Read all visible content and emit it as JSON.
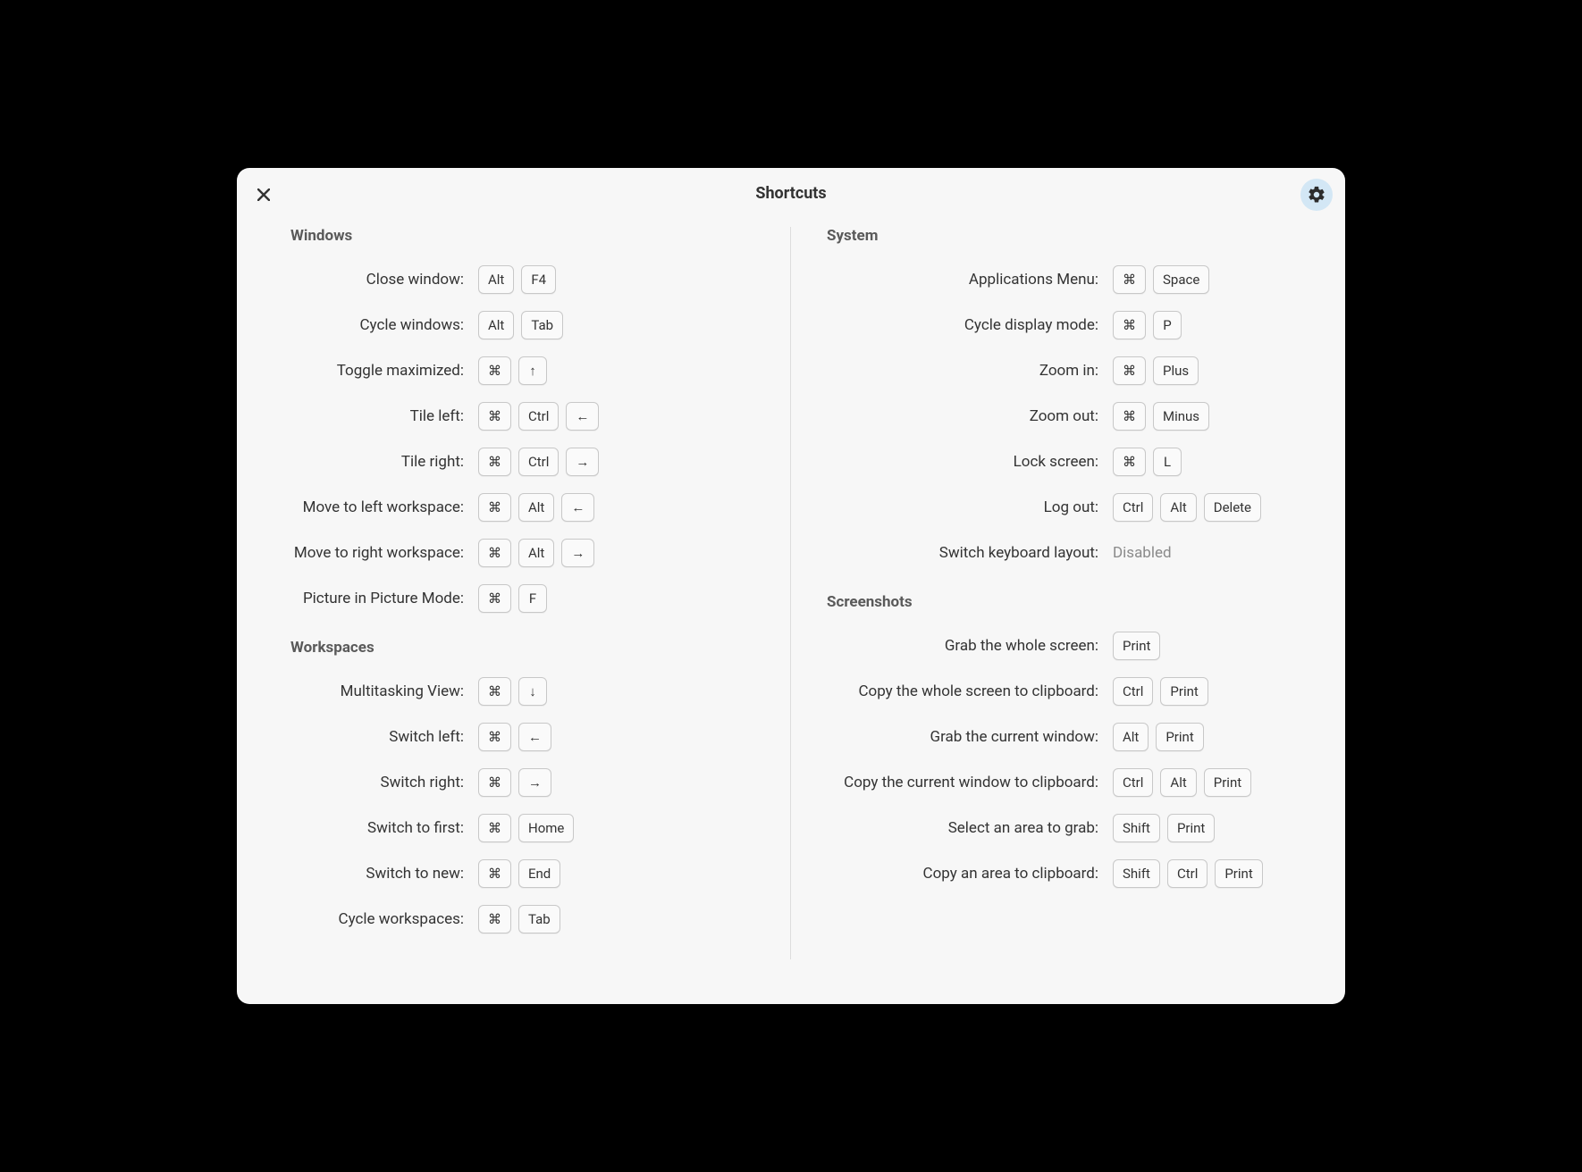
{
  "title": "Shortcuts",
  "glyphs": {
    "cmd": "⌘",
    "up": "↑",
    "down": "↓",
    "left": "←",
    "right": "→"
  },
  "left": {
    "sections": [
      {
        "title": "Windows",
        "name": "windows",
        "rows": [
          {
            "label": "Close window:",
            "name": "close-window",
            "keys": [
              "Alt",
              "F4"
            ]
          },
          {
            "label": "Cycle windows:",
            "name": "cycle-windows",
            "keys": [
              "Alt",
              "Tab"
            ]
          },
          {
            "label": "Toggle maximized:",
            "name": "toggle-maximized",
            "keys": [
              "cmd",
              "up"
            ]
          },
          {
            "label": "Tile left:",
            "name": "tile-left",
            "keys": [
              "cmd",
              "Ctrl",
              "left"
            ]
          },
          {
            "label": "Tile right:",
            "name": "tile-right",
            "keys": [
              "cmd",
              "Ctrl",
              "right"
            ]
          },
          {
            "label": "Move to left workspace:",
            "name": "move-left-workspace",
            "keys": [
              "cmd",
              "Alt",
              "left"
            ]
          },
          {
            "label": "Move to right workspace:",
            "name": "move-right-workspace",
            "keys": [
              "cmd",
              "Alt",
              "right"
            ]
          },
          {
            "label": "Picture in Picture Mode:",
            "name": "pip-mode",
            "keys": [
              "cmd",
              "F"
            ]
          }
        ]
      },
      {
        "title": "Workspaces",
        "name": "workspaces",
        "rows": [
          {
            "label": "Multitasking View:",
            "name": "multitasking-view",
            "keys": [
              "cmd",
              "down"
            ]
          },
          {
            "label": "Switch left:",
            "name": "switch-left",
            "keys": [
              "cmd",
              "left"
            ]
          },
          {
            "label": "Switch right:",
            "name": "switch-right",
            "keys": [
              "cmd",
              "right"
            ]
          },
          {
            "label": "Switch to first:",
            "name": "switch-first",
            "keys": [
              "cmd",
              "Home"
            ]
          },
          {
            "label": "Switch to new:",
            "name": "switch-new",
            "keys": [
              "cmd",
              "End"
            ]
          },
          {
            "label": "Cycle workspaces:",
            "name": "cycle-workspaces",
            "keys": [
              "cmd",
              "Tab"
            ]
          }
        ]
      }
    ]
  },
  "right": {
    "sections": [
      {
        "title": "System",
        "name": "system",
        "rows": [
          {
            "label": "Applications Menu:",
            "name": "applications-menu",
            "keys": [
              "cmd",
              "Space"
            ]
          },
          {
            "label": "Cycle display mode:",
            "name": "cycle-display-mode",
            "keys": [
              "cmd",
              "P"
            ]
          },
          {
            "label": "Zoom in:",
            "name": "zoom-in",
            "keys": [
              "cmd",
              "Plus"
            ]
          },
          {
            "label": "Zoom out:",
            "name": "zoom-out",
            "keys": [
              "cmd",
              "Minus"
            ]
          },
          {
            "label": "Lock screen:",
            "name": "lock-screen",
            "keys": [
              "cmd",
              "L"
            ]
          },
          {
            "label": "Log out:",
            "name": "log-out",
            "keys": [
              "Ctrl",
              "Alt",
              "Delete"
            ]
          },
          {
            "label": "Switch keyboard layout:",
            "name": "switch-keyboard-layout",
            "disabled": "Disabled"
          }
        ]
      },
      {
        "title": "Screenshots",
        "name": "screenshots",
        "rows": [
          {
            "label": "Grab the whole screen:",
            "name": "grab-whole-screen",
            "keys": [
              "Print"
            ]
          },
          {
            "label": "Copy the whole screen to clipboard:",
            "name": "copy-whole-screen",
            "keys": [
              "Ctrl",
              "Print"
            ]
          },
          {
            "label": "Grab the current window:",
            "name": "grab-current-window",
            "keys": [
              "Alt",
              "Print"
            ]
          },
          {
            "label": "Copy the current window to clipboard:",
            "name": "copy-current-window",
            "keys": [
              "Ctrl",
              "Alt",
              "Print"
            ]
          },
          {
            "label": "Select an area to grab:",
            "name": "select-area-grab",
            "keys": [
              "Shift",
              "Print"
            ]
          },
          {
            "label": "Copy an area to clipboard:",
            "name": "copy-area-clipboard",
            "keys": [
              "Shift",
              "Ctrl",
              "Print"
            ]
          }
        ]
      }
    ]
  }
}
